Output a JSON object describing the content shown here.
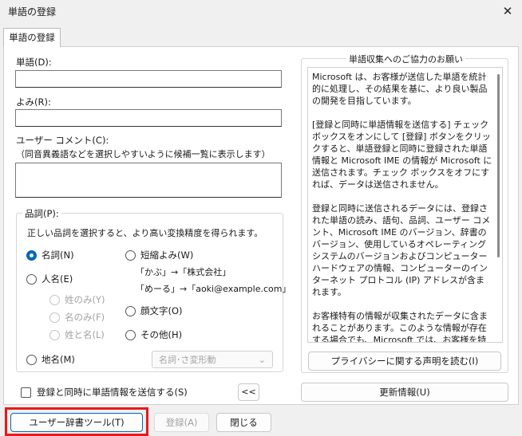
{
  "window": {
    "title": "単語の登録",
    "close_glyph": "✕"
  },
  "tab": {
    "label": "単語の登録"
  },
  "fields": {
    "word_label": "単語(D):",
    "word_value": "",
    "reading_label": "よみ(R):",
    "reading_value": "",
    "comment_label": "ユーザー コメント(C):",
    "comment_hint": "（同音異義語などを選択しやすいように候補一覧に表示します）",
    "comment_value": ""
  },
  "pos": {
    "legend": "品詞(P):",
    "description": "正しい品詞を選択すると、より高い変換精度を得られます。",
    "options": {
      "noun": "名詞(N)",
      "person": "人名(E)",
      "surname_only": "姓のみ(Y)",
      "given_only": "名のみ(F)",
      "full_name": "姓と名(L)",
      "place": "地名(M)",
      "short": "短縮よみ(W)",
      "example1": "「かぶ」→「株式会社」",
      "example2": "「めーる」→「aoki@example.com」",
      "emoticon": "顔文字(O)",
      "other": "その他(H)"
    },
    "selected": "noun",
    "subtype_select": "名詞･さ変形動"
  },
  "info_panel": {
    "legend": "単語収集へのご協力のお願い",
    "paragraphs": [
      "Microsoft は、お客様が送信した単語を統計的に処理し、その結果を基に、より良い製品の開発を目指しています。",
      "[登録と同時に単語情報を送信する] チェック ボックスをオンにして [登録] ボタンをクリックすると、単語登録と同時に登録された単語情報と Microsoft IME の情報が Microsoft に送信されます。チェック ボックスをオフにすれば、データは送信されません。",
      "登録と同時に送信されるデータには、登録された単語の読み、語句、品詞、ユーザー コメント、Microsoft IME のバージョン、辞書のバージョン、使用しているオペレーティング システムのバージョンおよびコンピューター ハードウェアの情報、コンピューターのインターネット プロトコル (IP) アドレスが含まれます。",
      "お客様特有の情報が収集されたデータに含まれることがあります。このような情報が存在する場合でも、Microsoft では、お客様を特定するために使用することはありません。"
    ],
    "privacy_button": "プライバシーに関する声明を読む(I)"
  },
  "send_checkbox": {
    "label": "登録と同時に単語情報を送信する(S)",
    "checked": false
  },
  "collapse_button": "<<",
  "update_button": "更新情報(U)",
  "footer": {
    "user_dict_tool": "ユーザー辞書ツール(T)",
    "register": "登録(A)",
    "close": "閉じる"
  },
  "colors": {
    "accent": "#0067c0",
    "highlight": "#e8191a"
  }
}
